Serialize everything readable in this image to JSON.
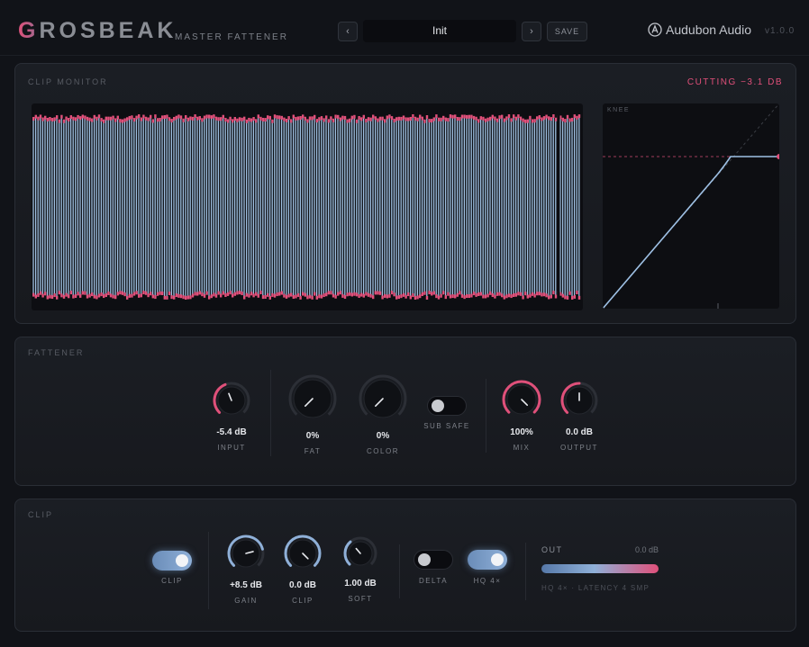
{
  "header": {
    "logo_first": "G",
    "logo_rest": "ROSBEAK",
    "subtitle": "MASTER FATTENER",
    "prev": "‹",
    "next": "›",
    "preset": "Init",
    "save": "SAVE",
    "brand": "Audubon Audio",
    "version": "v1.0.0"
  },
  "clip_monitor": {
    "title": "CLIP MONITOR",
    "status": "CUTTING −3.1 DB",
    "knee_label": "KNEE"
  },
  "fattener": {
    "title": "FATTENER",
    "knobs": [
      {
        "name": "input",
        "value": "-5.4 dB",
        "label": "INPUT",
        "level": 0.42,
        "color": "#e0507a"
      },
      {
        "name": "fat",
        "value": "0%",
        "label": "FAT",
        "level": 0.0,
        "color": "#e0507a"
      },
      {
        "name": "color",
        "value": "0%",
        "label": "COLOR",
        "level": 0.0,
        "color": "#e0507a"
      },
      {
        "name": "mix",
        "value": "100%",
        "label": "MIX",
        "level": 1.0,
        "color": "#e0507a"
      },
      {
        "name": "output",
        "value": "0.0 dB",
        "label": "OUTPUT",
        "level": 0.5,
        "color": "#e0507a"
      }
    ],
    "sub_safe": {
      "label": "SUB SAFE",
      "on": false
    }
  },
  "clip": {
    "title": "CLIP",
    "clip_toggle": {
      "label": "CLIP",
      "on": true
    },
    "knobs": [
      {
        "name": "gain",
        "value": "+8.5 dB",
        "label": "GAIN",
        "level": 0.78,
        "color": "#8fb0d8"
      },
      {
        "name": "clip",
        "value": "0.0 dB",
        "label": "CLIP",
        "level": 1.0,
        "color": "#8fb0d8"
      },
      {
        "name": "soft",
        "value": "1.00 dB",
        "label": "SOFT",
        "level": 0.35,
        "color": "#8fb0d8"
      }
    ],
    "delta": {
      "label": "DELTA",
      "on": false
    },
    "hq": {
      "label": "HQ 4×",
      "on": true
    },
    "out_label": "OUT",
    "out_value": "0.0 dB",
    "latency": "HQ 4× · LATENCY 4 SMP"
  },
  "colors": {
    "accent_pink": "#e0507a",
    "accent_blue": "#8fb0d8",
    "background": "#111318"
  }
}
